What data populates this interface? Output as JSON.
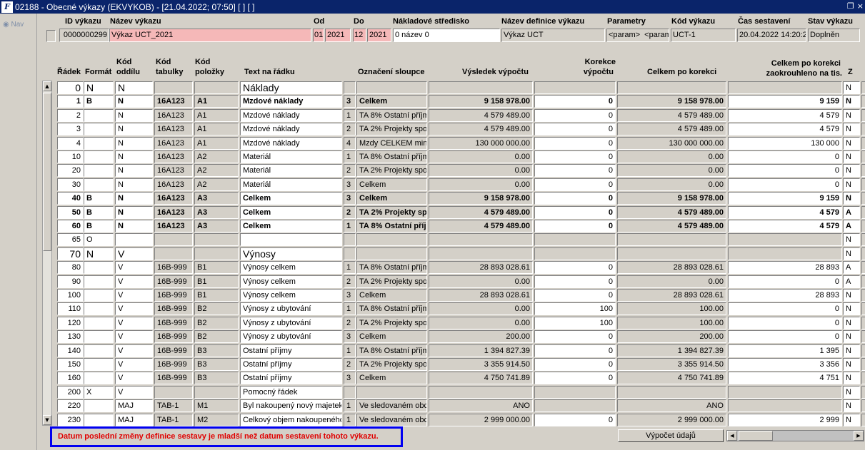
{
  "window": {
    "title": "02188 - Obecné výkazy (EKVYKOB) - [21.04.2022; 07:50]  [ ]  [ ]",
    "app_icon": "F",
    "restore_glyph": "❐",
    "close_glyph": "×"
  },
  "nav": {
    "label": "Nav"
  },
  "header_labels": {
    "id": "ID výkazu",
    "name": "Název výkazu",
    "od": "Od",
    "do": "Do",
    "nakl": "Nákladové středisko",
    "defname": "Název definice výkazu",
    "params": "Parametry",
    "kod": "Kód výkazu",
    "cas": "Čas sestavení",
    "stav": "Stav výkazu"
  },
  "header_values": {
    "id": "0000000299",
    "name": "Výkaz UCT_2021",
    "od_m": "01",
    "od_y": "2021",
    "do_m": "12",
    "do_y": "2021",
    "nakl": "0 název 0",
    "defname": "Výkaz UCT",
    "param1": "<param>",
    "param2": "<param>",
    "kod": "UCT-1",
    "cas": "20.04.2022 14:20:2",
    "stav": "Doplněn"
  },
  "col_headers": {
    "radek": "Řádek",
    "format": "Formát",
    "kod_oddilu_1": "Kód",
    "kod_oddilu_2": "oddílu",
    "kod_tab_1": "Kód",
    "kod_tab_2": "tabulky",
    "kod_pol_1": "Kód",
    "kod_pol_2": "položky",
    "text": "Text na řádku",
    "oznaceni": "Označení sloupce",
    "vysledek": "Výsledek výpočtu",
    "korekce_1": "Korekce",
    "korekce_2": "výpočtu",
    "celkem": "Celkem po korekci",
    "zaokr_1": "Celkem po korekci",
    "zaokr_2": "zaokrouhleno na tis.",
    "z": "Z"
  },
  "rows": [
    {
      "radek": "0",
      "format": "N",
      "oddil": "N",
      "tab": "",
      "pol": "",
      "text": "Náklady",
      "n": "",
      "ozn": "",
      "vys": "",
      "kor": "",
      "cel": "",
      "zao": "",
      "z": "N",
      "style": "big"
    },
    {
      "radek": "1",
      "format": "B",
      "oddil": "N",
      "tab": "16A123",
      "pol": "A1",
      "text": "Mzdové náklady",
      "n": "3",
      "ozn": "Celkem",
      "vys": "9 158 978.00",
      "kor": "0",
      "cel": "9 158 978.00",
      "zao": "9 159",
      "z": "N",
      "style": "b"
    },
    {
      "radek": "2",
      "format": "",
      "oddil": "N",
      "tab": "16A123",
      "pol": "A1",
      "text": "Mzdové náklady",
      "n": "1",
      "ozn": "TA 8% Ostatní příjm",
      "vys": "4 579 489.00",
      "kor": "0",
      "cel": "4 579 489.00",
      "zao": "4 579",
      "z": "N",
      "style": ""
    },
    {
      "radek": "3",
      "format": "",
      "oddil": "N",
      "tab": "16A123",
      "pol": "A1",
      "text": "Mzdové náklady",
      "n": "2",
      "ozn": "TA 2% Projekty spo",
      "vys": "4 579 489.00",
      "kor": "0",
      "cel": "4 579 489.00",
      "zao": "4 579",
      "z": "N",
      "style": ""
    },
    {
      "radek": "4",
      "format": "",
      "oddil": "N",
      "tab": "16A123",
      "pol": "A1",
      "text": "Mzdové náklady",
      "n": "4",
      "ozn": "Mzdy CELKEM minu",
      "vys": "130 000 000.00",
      "kor": "0",
      "cel": "130 000 000.00",
      "zao": "130 000",
      "z": "N",
      "style": ""
    },
    {
      "radek": "10",
      "format": "",
      "oddil": "N",
      "tab": "16A123",
      "pol": "A2",
      "text": "Materiál",
      "n": "1",
      "ozn": "TA 8% Ostatní příjm",
      "vys": "0.00",
      "kor": "0",
      "cel": "0.00",
      "zao": "0",
      "z": "N",
      "style": ""
    },
    {
      "radek": "20",
      "format": "",
      "oddil": "N",
      "tab": "16A123",
      "pol": "A2",
      "text": "Materiál",
      "n": "2",
      "ozn": "TA 2% Projekty spo",
      "vys": "0.00",
      "kor": "0",
      "cel": "0.00",
      "zao": "0",
      "z": "N",
      "style": ""
    },
    {
      "radek": "30",
      "format": "",
      "oddil": "N",
      "tab": "16A123",
      "pol": "A2",
      "text": "Materiál",
      "n": "3",
      "ozn": "Celkem",
      "vys": "0.00",
      "kor": "0",
      "cel": "0.00",
      "zao": "0",
      "z": "N",
      "style": ""
    },
    {
      "radek": "40",
      "format": "B",
      "oddil": "N",
      "tab": "16A123",
      "pol": "A3",
      "text": "Celkem",
      "n": "3",
      "ozn": "Celkem",
      "vys": "9 158 978.00",
      "kor": "0",
      "cel": "9 158 978.00",
      "zao": "9 159",
      "z": "N",
      "style": "b"
    },
    {
      "radek": "50",
      "format": "B",
      "oddil": "N",
      "tab": "16A123",
      "pol": "A3",
      "text": "Celkem",
      "n": "2",
      "ozn": "TA 2% Projekty sp",
      "vys": "4 579 489.00",
      "kor": "0",
      "cel": "4 579 489.00",
      "zao": "4 579",
      "z": "A",
      "style": "b"
    },
    {
      "radek": "60",
      "format": "B",
      "oddil": "N",
      "tab": "16A123",
      "pol": "A3",
      "text": "Celkem",
      "n": "1",
      "ozn": "TA 8% Ostatní příj",
      "vys": "4 579 489.00",
      "kor": "0",
      "cel": "4 579 489.00",
      "zao": "4 579",
      "z": "A",
      "style": "b"
    },
    {
      "radek": "65",
      "format": "O",
      "oddil": "",
      "tab": "",
      "pol": "",
      "text": "",
      "n": "",
      "ozn": "",
      "vys": "",
      "kor": "",
      "cel": "",
      "zao": "",
      "z": "N",
      "style": ""
    },
    {
      "radek": "70",
      "format": "N",
      "oddil": "V",
      "tab": "",
      "pol": "",
      "text": "Výnosy",
      "n": "",
      "ozn": "",
      "vys": "",
      "kor": "",
      "cel": "",
      "zao": "",
      "z": "N",
      "style": "big"
    },
    {
      "radek": "80",
      "format": "",
      "oddil": "V",
      "tab": "16B-999",
      "pol": "B1",
      "text": "Výnosy celkem",
      "n": "1",
      "ozn": "TA 8% Ostatní příjm",
      "vys": "28 893 028.61",
      "kor": "0",
      "cel": "28 893 028.61",
      "zao": "28 893",
      "z": "A",
      "style": ""
    },
    {
      "radek": "90",
      "format": "",
      "oddil": "V",
      "tab": "16B-999",
      "pol": "B1",
      "text": "Výnosy celkem",
      "n": "2",
      "ozn": "TA 2% Projekty spo",
      "vys": "0.00",
      "kor": "0",
      "cel": "0.00",
      "zao": "0",
      "z": "A",
      "style": ""
    },
    {
      "radek": "100",
      "format": "",
      "oddil": "V",
      "tab": "16B-999",
      "pol": "B1",
      "text": "Výnosy celkem",
      "n": "3",
      "ozn": "Celkem",
      "vys": "28 893 028.61",
      "kor": "0",
      "cel": "28 893 028.61",
      "zao": "28 893",
      "z": "N",
      "style": ""
    },
    {
      "radek": "110",
      "format": "",
      "oddil": "V",
      "tab": "16B-999",
      "pol": "B2",
      "text": "Výnosy z ubytování",
      "n": "1",
      "ozn": "TA 8% Ostatní příjm",
      "vys": "0.00",
      "kor": "100",
      "cel": "100.00",
      "zao": "0",
      "z": "N",
      "style": ""
    },
    {
      "radek": "120",
      "format": "",
      "oddil": "V",
      "tab": "16B-999",
      "pol": "B2",
      "text": "Výnosy z ubytování",
      "n": "2",
      "ozn": "TA 2% Projekty spo",
      "vys": "0.00",
      "kor": "100",
      "cel": "100.00",
      "zao": "0",
      "z": "N",
      "style": ""
    },
    {
      "radek": "130",
      "format": "",
      "oddil": "V",
      "tab": "16B-999",
      "pol": "B2",
      "text": "Výnosy z ubytování",
      "n": "3",
      "ozn": "Celkem",
      "vys": "200.00",
      "kor": "0",
      "cel": "200.00",
      "zao": "0",
      "z": "N",
      "style": ""
    },
    {
      "radek": "140",
      "format": "",
      "oddil": "V",
      "tab": "16B-999",
      "pol": "B3",
      "text": "Ostatní příjmy",
      "n": "1",
      "ozn": "TA 8% Ostatní příjm",
      "vys": "1 394 827.39",
      "kor": "0",
      "cel": "1 394 827.39",
      "zao": "1 395",
      "z": "N",
      "style": ""
    },
    {
      "radek": "150",
      "format": "",
      "oddil": "V",
      "tab": "16B-999",
      "pol": "B3",
      "text": "Ostatní příjmy",
      "n": "2",
      "ozn": "TA 2% Projekty spo",
      "vys": "3 355 914.50",
      "kor": "0",
      "cel": "3 355 914.50",
      "zao": "3 356",
      "z": "N",
      "style": ""
    },
    {
      "radek": "160",
      "format": "",
      "oddil": "V",
      "tab": "16B-999",
      "pol": "B3",
      "text": "Ostatní příjmy",
      "n": "3",
      "ozn": "Celkem",
      "vys": "4 750 741.89",
      "kor": "0",
      "cel": "4 750 741.89",
      "zao": "4 751",
      "z": "N",
      "style": ""
    },
    {
      "radek": "200",
      "format": "X",
      "oddil": "V",
      "tab": "",
      "pol": "",
      "text": "Pomocný řádek",
      "n": "",
      "ozn": "",
      "vys": "",
      "kor": "",
      "cel": "",
      "zao": "",
      "z": "N",
      "style": ""
    },
    {
      "radek": "220",
      "format": "",
      "oddil": "MAJ",
      "tab": "TAB-1",
      "pol": "M1",
      "text": "Byl nakoupený nový majetek",
      "n": "1",
      "ozn": "Ve sledovaném obc",
      "vys": "ANO",
      "kor": "",
      "cel": "ANO",
      "zao": "",
      "z": "N",
      "style": ""
    },
    {
      "radek": "230",
      "format": "",
      "oddil": "MAJ",
      "tab": "TAB-1",
      "pol": "M2",
      "text": "Celkový objem nakoupeného",
      "n": "1",
      "ozn": "Ve sledovaném obc",
      "vys": "2 999 000.00",
      "kor": "0",
      "cel": "2 999 000.00",
      "zao": "2 999",
      "z": "N",
      "style": ""
    }
  ],
  "warning": "Datum poslední změny definice sestavy je mladší než datum sestavení tohoto výkazu.",
  "calc_button": "Výpočet údajů",
  "colors": {
    "titlebar": "#0a246a",
    "window_bg": "#d4d0c8",
    "header_pink": "#f5b8b8",
    "warning_text": "#e00000",
    "warning_border": "#0000f0"
  }
}
